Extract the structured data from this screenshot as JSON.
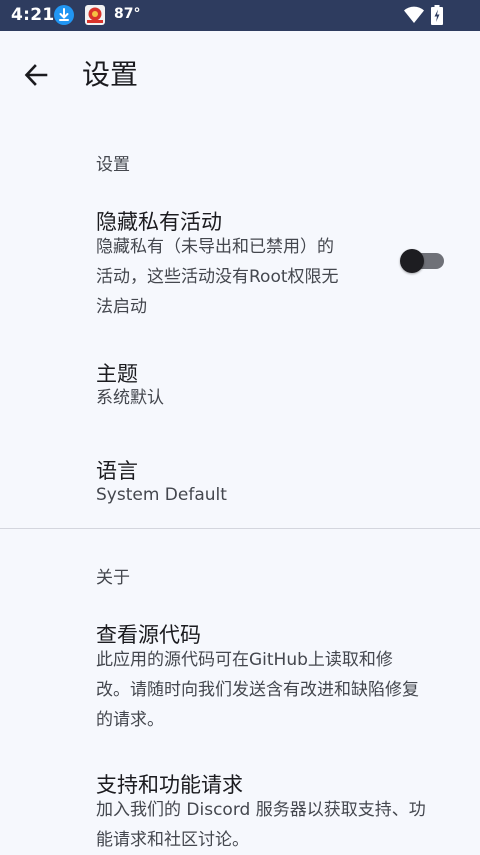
{
  "status_bar": {
    "time": "4:21",
    "temperature": "87°",
    "icons": [
      "download-icon",
      "app-notification-icon",
      "wifi-icon",
      "battery-charging-icon"
    ]
  },
  "app_bar": {
    "title": "设置",
    "back_icon": "arrow-back-icon"
  },
  "sections": {
    "settings": {
      "header": "设置",
      "hide_private": {
        "title": "隐藏私有活动",
        "description_lines": [
          "隐藏私有（未导出和已禁用）的",
          "活动，这些活动没有Root权限无",
          "法启动"
        ],
        "toggle_on": false
      },
      "theme": {
        "title": "主题",
        "value": "系统默认"
      },
      "language": {
        "title": "语言",
        "value": "System Default"
      }
    },
    "about": {
      "header": "关于",
      "source": {
        "title": "查看源代码",
        "description_lines": [
          "此应用的源代码可在GitHub上读取和修",
          "改。请随时向我们发送含有改进和缺陷修复",
          "的请求。"
        ]
      },
      "support": {
        "title": "支持和功能请求",
        "description_lines": [
          "加入我们的 Discord 服务器以获取支持、功",
          "能请求和社区讨论。"
        ]
      }
    }
  },
  "colors": {
    "background": "#f6f8fd",
    "status_bar": "#2e3c5f",
    "primary_text": "#1b1b1f",
    "secondary_text": "#44474e"
  }
}
